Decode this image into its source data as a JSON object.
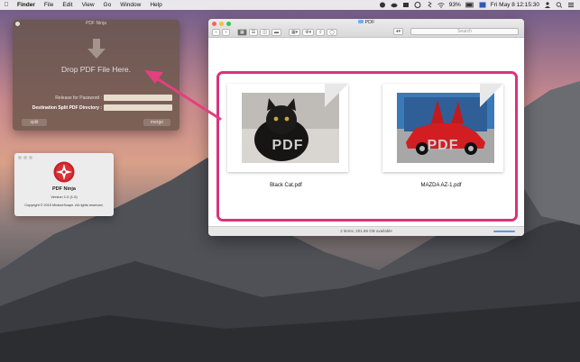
{
  "menubar": {
    "app": "Finder",
    "items": [
      "File",
      "Edit",
      "View",
      "Go",
      "Window",
      "Help"
    ],
    "battery": "93%",
    "clock": "Fri May 8  12:15:30"
  },
  "ninja": {
    "title": "PDF Ninja",
    "drop_label": "Drop PDF File Here.",
    "password_label": "Release for Password :",
    "dest_label": "Destination Split PDF Directory :",
    "split_button": "split",
    "merge_button": "merge"
  },
  "about": {
    "name": "PDF Ninja",
    "version": "Version 1.0 (1.0)",
    "copyright": "Copyright © 2015 MixtureScape. All rights reserved."
  },
  "finder": {
    "title": "PDF",
    "search_placeholder": "Search",
    "files": [
      {
        "name": "Black Cat.pdf",
        "stamp": "PDF"
      },
      {
        "name": "MAZDA AZ-1.pdf",
        "stamp": "PDF"
      }
    ],
    "status": "2 items, 201.86 GB available"
  },
  "colors": {
    "highlight": "#d9337e"
  },
  "icons": {
    "apple": "apple-icon",
    "drop_arrow": "down-arrow-icon",
    "about_app": "ninja-star-icon"
  }
}
